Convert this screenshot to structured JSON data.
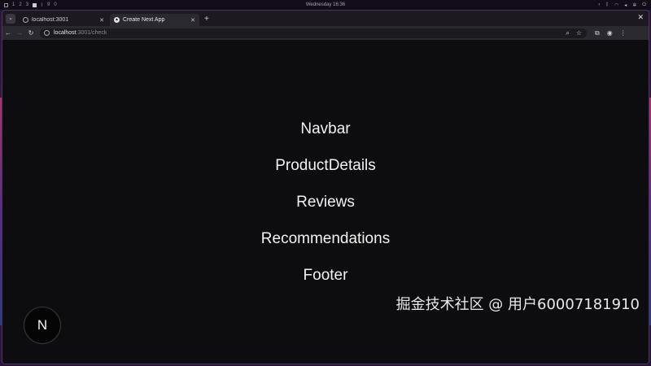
{
  "os_bar": {
    "workspaces": [
      "1",
      "2",
      "3"
    ],
    "extra_marks": [
      "9",
      "0"
    ],
    "clock": "Wednesday 16:36"
  },
  "browser": {
    "tabs": [
      {
        "title": "localhost:3001",
        "icon": "globe-icon",
        "active": false
      },
      {
        "title": "Create Next App",
        "icon": "nextjs-icon",
        "active": true
      }
    ],
    "new_tab_label": "+",
    "url_host": "localhost",
    "url_path": ":3001/check"
  },
  "page": {
    "components": [
      "Navbar",
      "ProductDetails",
      "Reviews",
      "Recommendations",
      "Footer"
    ],
    "next_badge_letter": "N"
  },
  "watermark": "掘金技术社区 @ 用户60007181910",
  "colors": {
    "background": "#0d0c0e",
    "text": "#f2f2f2",
    "accent_edge": "#b0306a"
  }
}
